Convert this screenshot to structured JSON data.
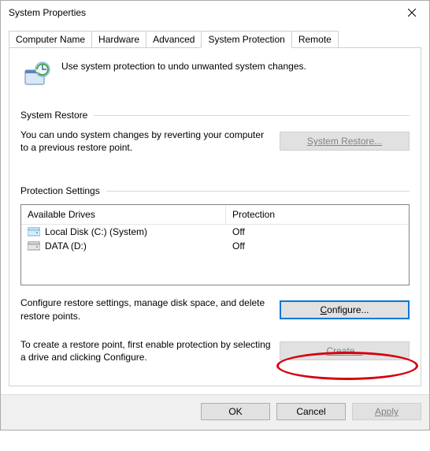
{
  "window": {
    "title": "System Properties"
  },
  "tabs": {
    "t0": "Computer Name",
    "t1": "Hardware",
    "t2": "Advanced",
    "t3": "System Protection",
    "t4": "Remote"
  },
  "intro": "Use system protection to undo unwanted system changes.",
  "restore": {
    "heading": "System Restore",
    "desc": "You can undo system changes by reverting your computer to a previous restore point.",
    "button": "System Restore..."
  },
  "settings": {
    "heading": "Protection Settings",
    "col_drives": "Available Drives",
    "col_protection": "Protection",
    "drives": [
      {
        "name": "Local Disk (C:) (System)",
        "protection": "Off"
      },
      {
        "name": "DATA (D:)",
        "protection": "Off"
      }
    ],
    "configure_desc": "Configure restore settings, manage disk space, and delete restore points.",
    "configure_button": "Configure...",
    "create_desc": "To create a restore point, first enable protection by selecting a drive and clicking Configure.",
    "create_button": "Create..."
  },
  "footer": {
    "ok": "OK",
    "cancel": "Cancel",
    "apply": "Apply"
  }
}
